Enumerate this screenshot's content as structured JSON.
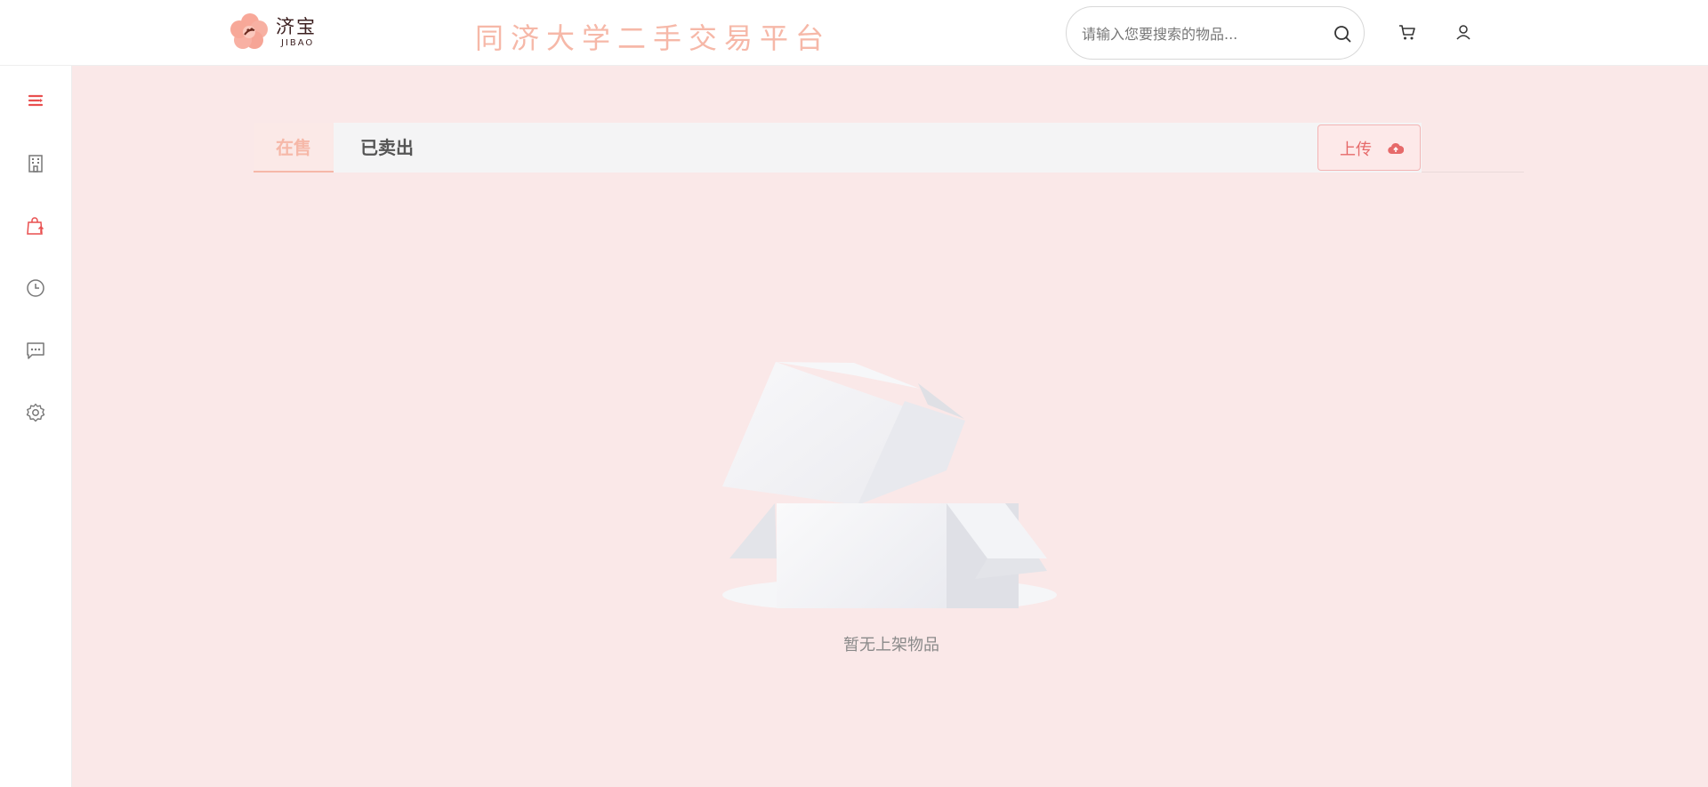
{
  "app": {
    "logo_cn": "济宝",
    "logo_en": "JIBAO",
    "slogan": "同济大学二手交易平台"
  },
  "search": {
    "placeholder": "请输入您要搜索的物品..."
  },
  "header_icons": [
    "search-icon",
    "cart-icon",
    "user-icon"
  ],
  "sidebar": {
    "items": [
      {
        "name": "menu-toggle",
        "icon": "menu-icon"
      },
      {
        "name": "building",
        "icon": "building-icon"
      },
      {
        "name": "my-sales",
        "icon": "shopping-bag-upload-icon"
      },
      {
        "name": "history",
        "icon": "clock-icon"
      },
      {
        "name": "messages",
        "icon": "chat-icon"
      },
      {
        "name": "settings",
        "icon": "gear-icon"
      }
    ]
  },
  "tabs": [
    {
      "label": "在售",
      "active": true
    },
    {
      "label": "已卖出",
      "active": false
    }
  ],
  "upload_button": {
    "label": "上传",
    "icon": "cloud-upload-icon"
  },
  "empty_state": {
    "text": "暂无上架物品",
    "icon": "empty-box-illustration"
  },
  "colors": {
    "accent": "#f6b8a8",
    "upload_text": "#e66a6a",
    "main_background": "#fae8e8",
    "active_sidebar_icon": "#e94f4f"
  }
}
